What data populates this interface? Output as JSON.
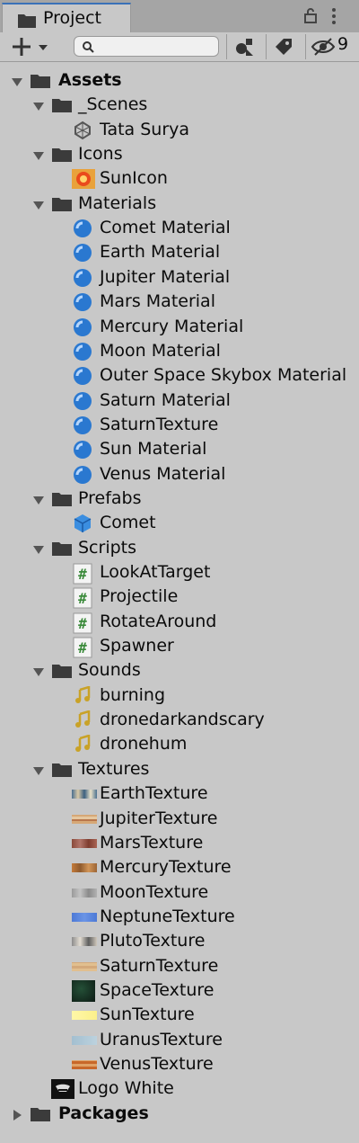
{
  "window": {
    "tab_title": "Project",
    "hidden_count": "9",
    "search": {
      "placeholder": ""
    }
  },
  "colors": {
    "material_blue": "#2a78d0",
    "script_green": "#3a8a3a",
    "sound_gold": "#c9a227",
    "prefab_blue": "#3b8ee0",
    "accent": "#3a72b8"
  },
  "tree": {
    "assets": "Assets",
    "scenes": {
      "label": "_Scenes",
      "items": [
        "Tata Surya"
      ]
    },
    "icons": {
      "label": "Icons",
      "items": [
        "SunIcon"
      ]
    },
    "materials": {
      "label": "Materials",
      "items": [
        "Comet Material",
        "Earth Material",
        "Jupiter Material",
        "Mars Material",
        "Mercury Material",
        "Moon Material",
        "Outer Space Skybox Material",
        "Saturn Material",
        "SaturnTexture",
        "Sun Material",
        "Venus Material"
      ]
    },
    "prefabs": {
      "label": "Prefabs",
      "items": [
        "Comet"
      ]
    },
    "scripts": {
      "label": "Scripts",
      "items": [
        "LookAtTarget",
        "Projectile",
        "RotateAround",
        "Spawner"
      ]
    },
    "sounds": {
      "label": "Sounds",
      "items": [
        "burning",
        "dronedarkandscary",
        "dronehum"
      ]
    },
    "textures": {
      "label": "Textures",
      "items": [
        "EarthTexture",
        "JupiterTexture",
        "MarsTexture",
        "MercuryTexture",
        "MoonTexture",
        "NeptuneTexture",
        "PlutoTexture",
        "SaturnTexture",
        "SpaceTexture",
        "SunTexture",
        "UranusTexture",
        "VenusTexture"
      ]
    },
    "logo": "Logo White",
    "packages": "Packages"
  }
}
